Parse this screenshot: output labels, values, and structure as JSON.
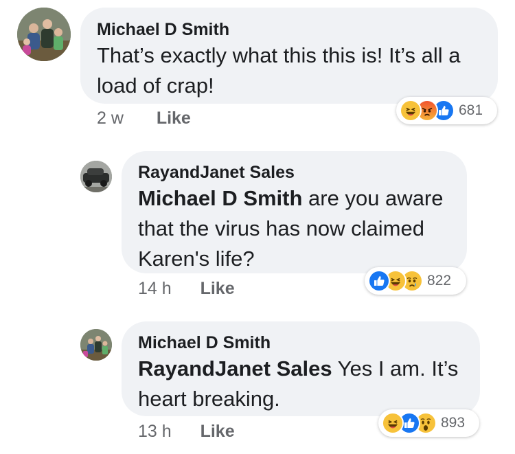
{
  "comments": [
    {
      "author": "Michael D Smith",
      "mention": "",
      "text": "That’s exactly what this this is! It’s all a load of crap!",
      "time": "2 w",
      "like_label": "Like",
      "reactions": [
        "haha-icon",
        "angry-icon",
        "like-icon"
      ],
      "reaction_count": "681"
    },
    {
      "author": "RayandJanet Sales",
      "mention": "Michael D Smith",
      "text": " are you aware that the virus has now claimed Karen's life?",
      "time": "14 h",
      "like_label": "Like",
      "reactions": [
        "like-icon",
        "haha-icon",
        "sad-icon"
      ],
      "reaction_count": "822"
    },
    {
      "author": "Michael D Smith",
      "mention": "RayandJanet Sales",
      "text": " Yes I am. It’s heart breaking.",
      "time": "13 h",
      "like_label": "Like",
      "reactions": [
        "haha-icon",
        "like-icon",
        "wow-icon"
      ],
      "reaction_count": "893"
    }
  ],
  "colors": {
    "bubble": "#f0f2f5",
    "like_blue": "#1877f2",
    "emoji_yellow": "#f7c23a",
    "angry_orange": "#f0542e",
    "meta_gray": "#65676b"
  }
}
